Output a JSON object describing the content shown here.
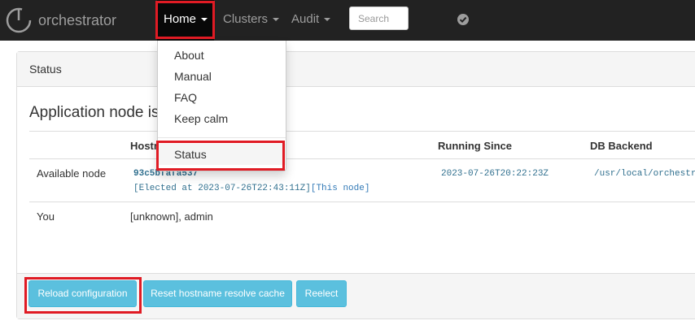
{
  "app": {
    "title": "orchestrator"
  },
  "nav": {
    "home": "Home",
    "clusters": "Clusters",
    "audit": "Audit",
    "search_placeholder": "Search"
  },
  "dropdown": {
    "items": [
      "About",
      "Manual",
      "FAQ",
      "Keep calm"
    ],
    "status": "Status"
  },
  "panel": {
    "heading": "Status",
    "app_heading": "Application node is",
    "columns": [
      "Hostname",
      "Running Since",
      "DB Backend"
    ],
    "hostname_visible": "Hostn",
    "rows": [
      {
        "label": "Available node",
        "hostname": "93c5bfafa537",
        "elected": "[Elected at 2023-07-26T22:43:11Z]",
        "this_node": "[This node]",
        "running_since": "2023-07-26T20:22:23Z",
        "db_backend": "/usr/local/orchestr"
      },
      {
        "label": "You",
        "value": "[unknown], admin"
      }
    ]
  },
  "buttons": {
    "reload": "Reload configuration",
    "reset": "Reset hostname resolve cache",
    "reelect": "Reelect"
  },
  "colors": {
    "navbar": "#222222",
    "highlight": "#e01b24",
    "button": "#5bc0de"
  }
}
